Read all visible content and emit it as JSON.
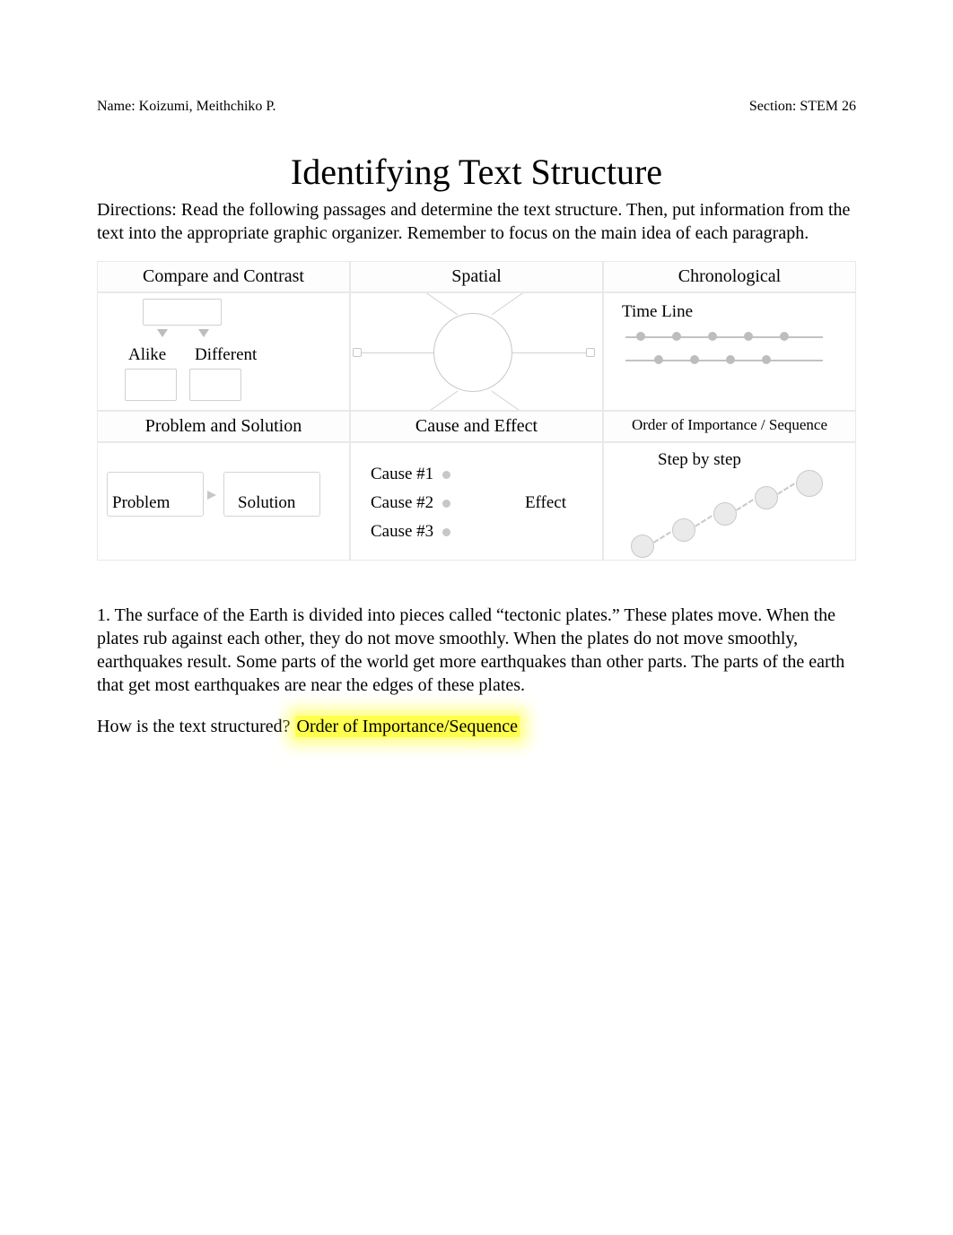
{
  "header": {
    "name_label": "Name:",
    "name_value": "Koizumi, Meithchiko P.",
    "section_label": "Section:",
    "section_value": "STEM 26"
  },
  "title": "Identifying Text Structure",
  "directions": "Directions:   Read the following passages and determine the text structure. Then, put information from the text into the appropriate graphic organizer.   Remember to focus on the main idea of each paragraph.",
  "organizers": {
    "compare_contrast": {
      "title": "Compare and Contrast",
      "left_label": "Alike",
      "right_label": "Different"
    },
    "spatial": {
      "title": "Spatial"
    },
    "chronological": {
      "title": "Chronological",
      "caption": "Time Line"
    },
    "problem_solution": {
      "title": "Problem and Solution",
      "left_label": "Problem",
      "right_label": "Solution"
    },
    "cause_effect": {
      "title": "Cause and Effect",
      "cause1": "Cause #1",
      "cause2": "Cause #2",
      "cause3": "Cause #3",
      "effect": "Effect"
    },
    "sequence": {
      "title": "Order of Importance / Sequence",
      "caption": "Step by step"
    }
  },
  "question1": {
    "passage": "1. The surface of the Earth is divided into pieces called “tectonic plates.”   These plates move. When the plates rub against each other, they do not move smoothly. When the plates do not move smoothly, earthquakes result.   Some parts of the world get more earthquakes than other parts. The parts of the earth that get most earthquakes are near the edges of these plates.",
    "prompt": "How is the text structured? ",
    "answer": "Order of Importance/Sequence"
  }
}
